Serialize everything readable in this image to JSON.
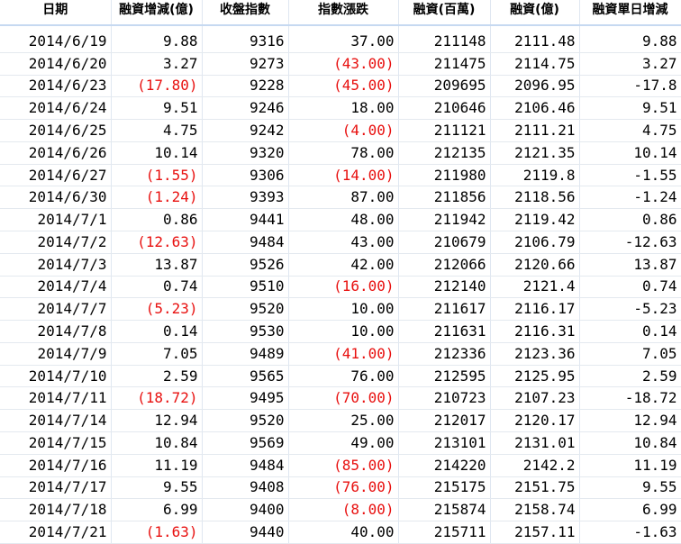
{
  "colors": {
    "negative": "#e8100f",
    "text": "#000000",
    "gridline": "#dfe7f1"
  },
  "headers": [
    "日期",
    "融資增減(億)",
    "收盤指數",
    "指數漲跌",
    "融資(百萬)",
    "融資(億)",
    "融資單日增減"
  ],
  "rows": [
    [
      "2014/6/19",
      "9.88",
      "9316",
      "37.00",
      "211148",
      "2111.48",
      "9.88"
    ],
    [
      "2014/6/20",
      "3.27",
      "9273",
      "(43.00)",
      "211475",
      "2114.75",
      "3.27"
    ],
    [
      "2014/6/23",
      "(17.80)",
      "9228",
      "(45.00)",
      "209695",
      "2096.95",
      "-17.8"
    ],
    [
      "2014/6/24",
      "9.51",
      "9246",
      "18.00",
      "210646",
      "2106.46",
      "9.51"
    ],
    [
      "2014/6/25",
      "4.75",
      "9242",
      "(4.00)",
      "211121",
      "2111.21",
      "4.75"
    ],
    [
      "2014/6/26",
      "10.14",
      "9320",
      "78.00",
      "212135",
      "2121.35",
      "10.14"
    ],
    [
      "2014/6/27",
      "(1.55)",
      "9306",
      "(14.00)",
      "211980",
      "2119.8",
      "-1.55"
    ],
    [
      "2014/6/30",
      "(1.24)",
      "9393",
      "87.00",
      "211856",
      "2118.56",
      "-1.24"
    ],
    [
      "2014/7/1",
      "0.86",
      "9441",
      "48.00",
      "211942",
      "2119.42",
      "0.86"
    ],
    [
      "2014/7/2",
      "(12.63)",
      "9484",
      "43.00",
      "210679",
      "2106.79",
      "-12.63"
    ],
    [
      "2014/7/3",
      "13.87",
      "9526",
      "42.00",
      "212066",
      "2120.66",
      "13.87"
    ],
    [
      "2014/7/4",
      "0.74",
      "9510",
      "(16.00)",
      "212140",
      "2121.4",
      "0.74"
    ],
    [
      "2014/7/7",
      "(5.23)",
      "9520",
      "10.00",
      "211617",
      "2116.17",
      "-5.23"
    ],
    [
      "2014/7/8",
      "0.14",
      "9530",
      "10.00",
      "211631",
      "2116.31",
      "0.14"
    ],
    [
      "2014/7/9",
      "7.05",
      "9489",
      "(41.00)",
      "212336",
      "2123.36",
      "7.05"
    ],
    [
      "2014/7/10",
      "2.59",
      "9565",
      "76.00",
      "212595",
      "2125.95",
      "2.59"
    ],
    [
      "2014/7/11",
      "(18.72)",
      "9495",
      "(70.00)",
      "210723",
      "2107.23",
      "-18.72"
    ],
    [
      "2014/7/14",
      "12.94",
      "9520",
      "25.00",
      "212017",
      "2120.17",
      "12.94"
    ],
    [
      "2014/7/15",
      "10.84",
      "9569",
      "49.00",
      "213101",
      "2131.01",
      "10.84"
    ],
    [
      "2014/7/16",
      "11.19",
      "9484",
      "(85.00)",
      "214220",
      "2142.2",
      "11.19"
    ],
    [
      "2014/7/17",
      "9.55",
      "9408",
      "(76.00)",
      "215175",
      "2151.75",
      "9.55"
    ],
    [
      "2014/7/18",
      "6.99",
      "9400",
      "(8.00)",
      "215874",
      "2158.74",
      "6.99"
    ],
    [
      "2014/7/21",
      "(1.63)",
      "9440",
      "40.00",
      "215711",
      "2157.11",
      "-1.63"
    ]
  ]
}
